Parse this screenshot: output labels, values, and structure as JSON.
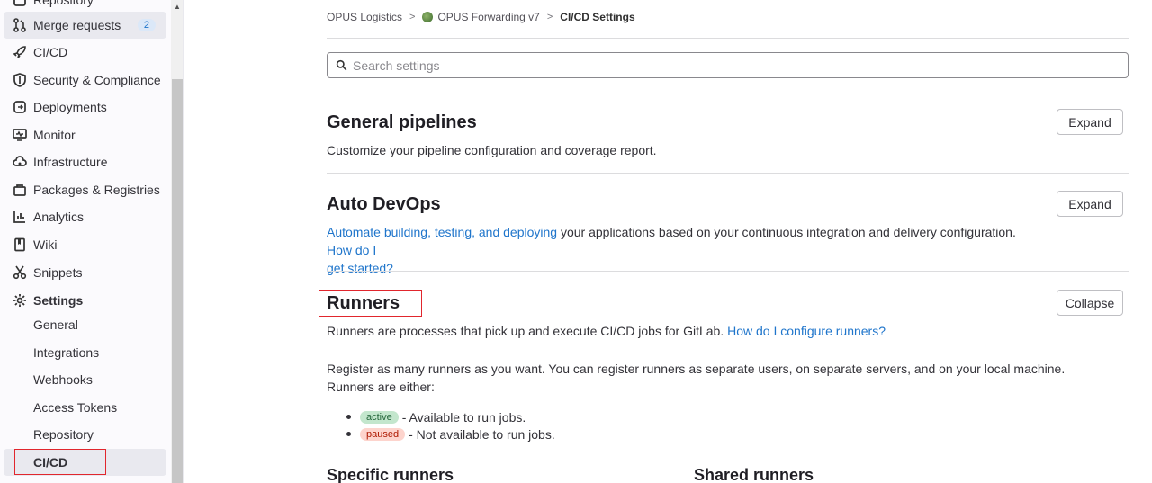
{
  "sidebar": {
    "items": [
      {
        "label": "Repository",
        "icon": "repository-icon"
      },
      {
        "label": "Merge requests",
        "icon": "merge-request-icon",
        "count": "2"
      },
      {
        "label": "CI/CD",
        "icon": "rocket-icon"
      },
      {
        "label": "Security & Compliance",
        "icon": "shield-icon"
      },
      {
        "label": "Deployments",
        "icon": "deployments-icon"
      },
      {
        "label": "Monitor",
        "icon": "monitor-icon"
      },
      {
        "label": "Infrastructure",
        "icon": "cloud-gear-icon"
      },
      {
        "label": "Packages & Registries",
        "icon": "package-icon"
      },
      {
        "label": "Analytics",
        "icon": "chart-icon"
      },
      {
        "label": "Wiki",
        "icon": "book-icon"
      },
      {
        "label": "Snippets",
        "icon": "scissors-icon"
      },
      {
        "label": "Settings",
        "icon": "gear-icon"
      }
    ],
    "settings_sub": [
      "General",
      "Integrations",
      "Webhooks",
      "Access Tokens",
      "Repository",
      "CI/CD"
    ]
  },
  "breadcrumb": {
    "group": "OPUS Logistics",
    "project": "OPUS Forwarding v7",
    "current": "CI/CD Settings"
  },
  "search": {
    "placeholder": "Search settings"
  },
  "sections": {
    "general_pipelines": {
      "title": "General pipelines",
      "desc": "Customize your pipeline configuration and coverage report.",
      "button": "Expand"
    },
    "auto_devops": {
      "title": "Auto DevOps",
      "link1": "Automate building, testing, and deploying",
      "desc": " your applications based on your continuous integration and delivery configuration. ",
      "link2_a": "How do I",
      "link2_b": "get started?",
      "button": "Expand"
    },
    "runners": {
      "title": "Runners",
      "desc": "Runners are processes that pick up and execute CI/CD jobs for GitLab. ",
      "desc_link": "How do I configure runners?",
      "button": "Collapse",
      "register_line1": "Register as many runners as you want. You can register runners as separate users, on separate servers, and on your local machine.",
      "register_line2": "Runners are either:",
      "states": [
        {
          "badge": "active",
          "text": " - Available to run jobs."
        },
        {
          "badge": "paused",
          "text": " - Not available to run jobs."
        }
      ],
      "specific_title": "Specific runners",
      "shared_title": "Shared runners"
    }
  },
  "colors": {
    "link": "#1f75cb",
    "highlight": "#e1262d"
  }
}
